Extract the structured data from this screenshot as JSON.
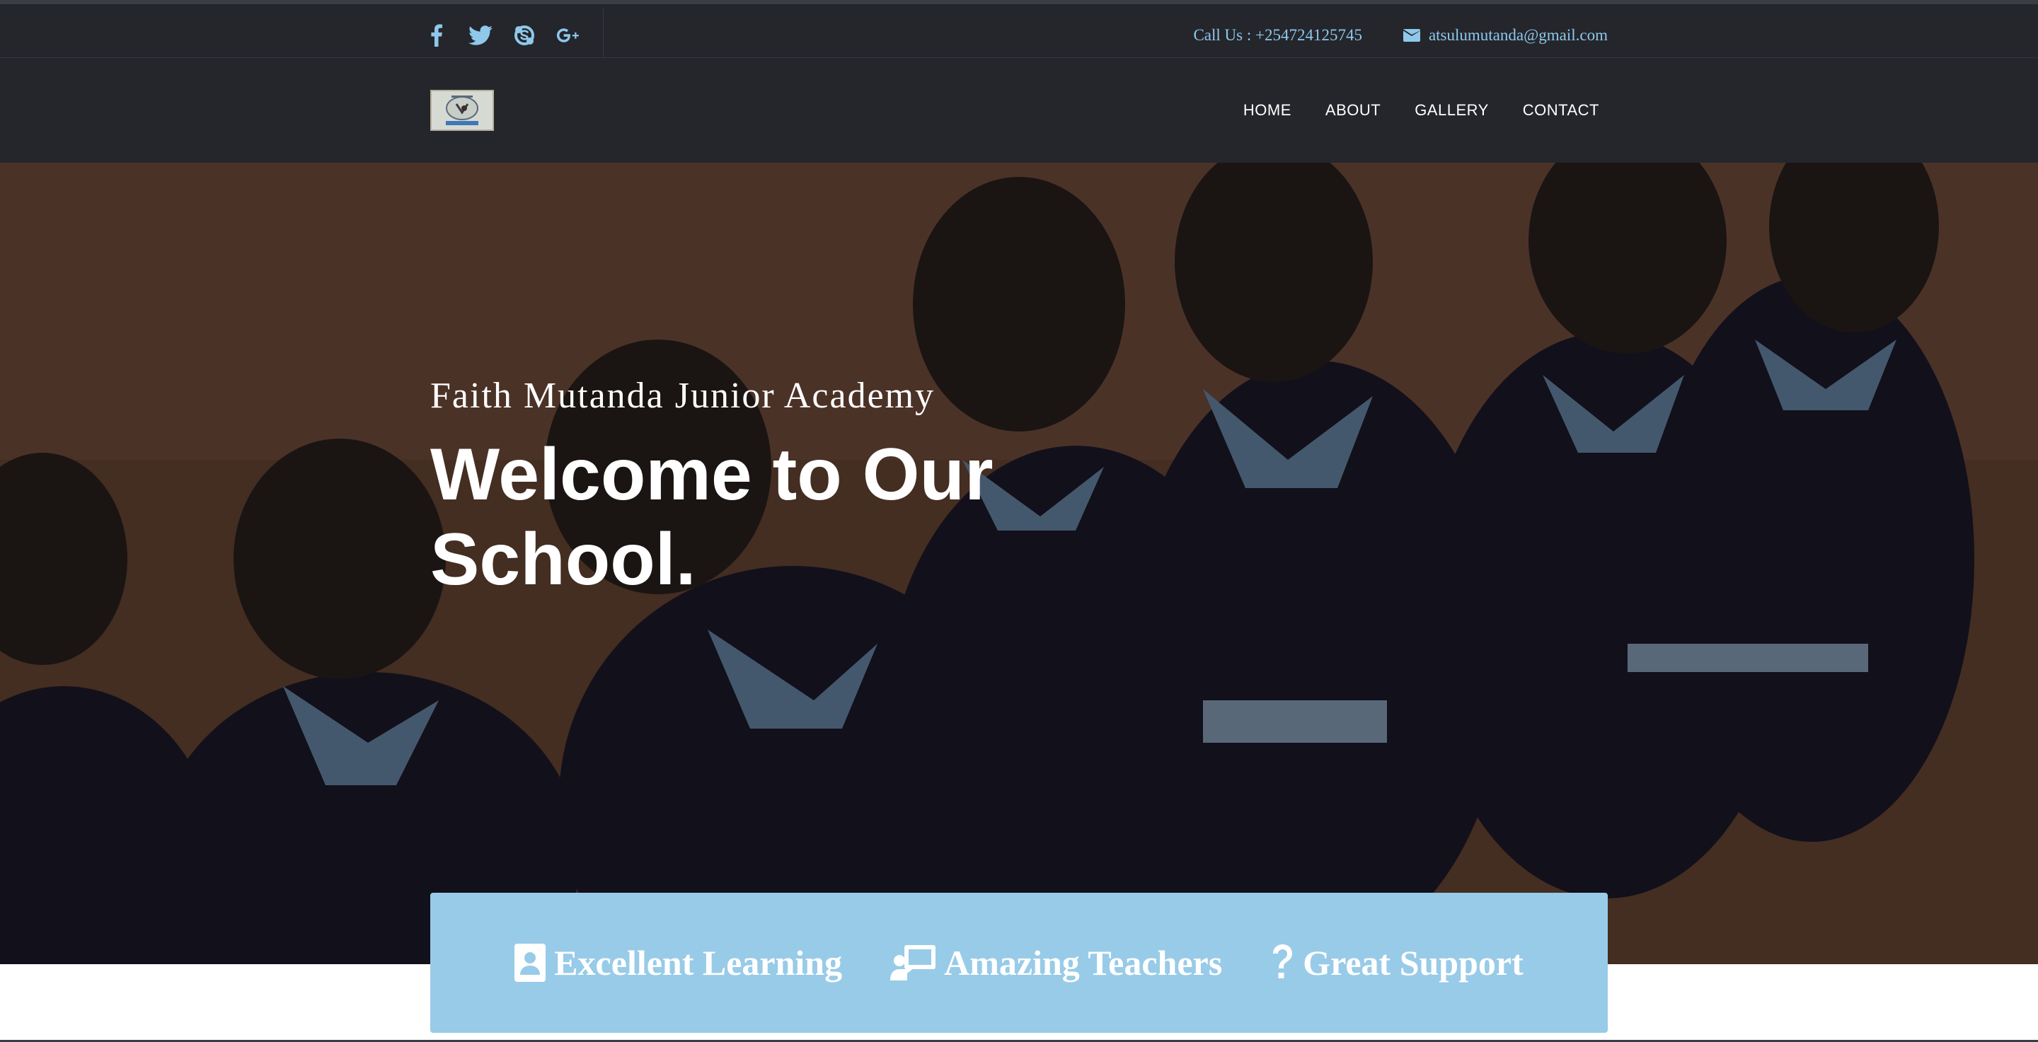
{
  "topbar": {
    "social": [
      {
        "icon": "facebook-icon"
      },
      {
        "icon": "twitter-icon"
      },
      {
        "icon": "skype-icon"
      },
      {
        "icon": "google-plus-icon"
      }
    ],
    "phone_text": "Call Us : +254724125745",
    "email_text": "atsulumutanda@gmail.com",
    "accent_color": "#8fc8ea"
  },
  "nav": {
    "logo": "school-logo",
    "items": [
      {
        "label": "HOME"
      },
      {
        "label": "ABOUT"
      },
      {
        "label": "GALLERY"
      },
      {
        "label": "CONTACT"
      }
    ]
  },
  "hero": {
    "subtitle": "Faith Mutanda Junior Academy",
    "headline": "Welcome to Our School.",
    "image": "children-in-school-uniform-photo"
  },
  "features": {
    "background": "#98cbe8",
    "items": [
      {
        "icon": "id-card-icon",
        "label": "Excellent Learning"
      },
      {
        "icon": "teacher-board-icon",
        "label": "Amazing Teachers"
      },
      {
        "icon": "question-icon",
        "label": "Great Support"
      }
    ]
  }
}
